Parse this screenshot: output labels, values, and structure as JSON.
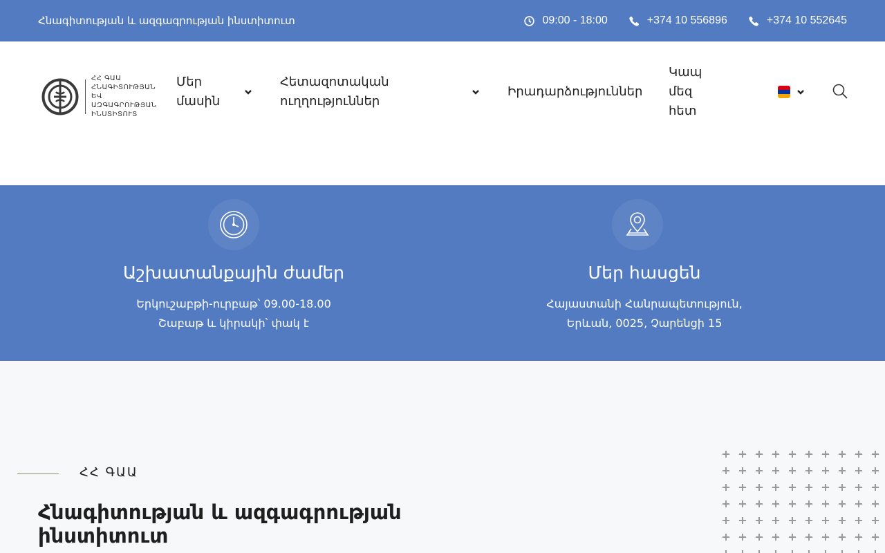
{
  "topbar": {
    "institute_name": "Հնագիտության և ազգագրության ինստիտուտ",
    "hours": "09:00 - 18:00",
    "phone_1": "+374 10 556896",
    "phone_2": "+374 10 552645"
  },
  "logo": {
    "line_1": "ՀՀ ԳԱԱ",
    "line_2": "ՀՆԱԳԻՏՈՒԹՅԱՆ ԵՎ",
    "line_3": "ԱԶԳԱԳՐՈՒԹՅԱՆ",
    "line_4": "ԻՆՍՏԻՏՈՒՏ"
  },
  "nav": {
    "about": {
      "line_1": "Մեր",
      "line_2": "մասին"
    },
    "research": {
      "line_1": "Հետազոտական",
      "line_2": "ուղղություններ"
    },
    "events": "Իրադարձություններ",
    "contact": {
      "line_1": "Կապ մեզ",
      "line_2": "հետ"
    }
  },
  "language": {
    "selected": "hy",
    "flag_colors": [
      "#d90012",
      "#0033a0",
      "#f2a800"
    ]
  },
  "info": {
    "hours": {
      "title": "Աշխատանքային ժամեր",
      "line_1": "Երկուշաբթի-ուրբաթ՝ 09.00-18.00",
      "line_2": "Շաբաթ և կիրակի՝ փակ է"
    },
    "address": {
      "title": "Մեր հասցեն",
      "line_1": "Հայաստանի Հանրապետություն,",
      "line_2": "Երևան, 0025, Չարենցի 15"
    }
  },
  "about": {
    "eyebrow": "ՀՀ ԳԱԱ",
    "title": "Հնագիտության և ազգագրության ինստիտուտ"
  },
  "colors": {
    "brand_blue": "#527bc2",
    "white": "#ffffff",
    "page_bg": "#f7f8fa"
  },
  "icons": {
    "topbar_hours": "clock-icon",
    "topbar_phone": "phone-icon",
    "nav_dropdown": "chevron-down-icon",
    "search": "search-icon",
    "info_hours": "clock-icon",
    "info_address": "map-pin-icon"
  }
}
